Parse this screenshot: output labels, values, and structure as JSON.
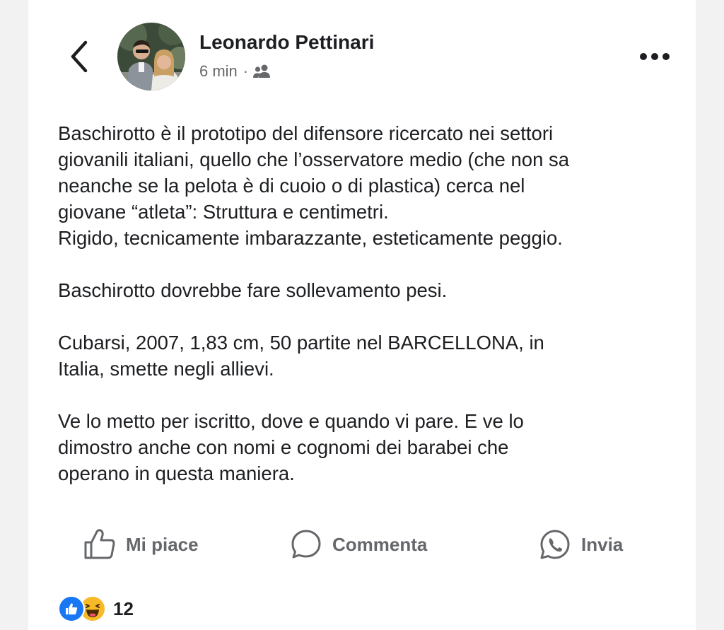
{
  "header": {
    "back_icon": "chevron-left-icon",
    "author_name": "Leonardo Pettinari",
    "time": "6 min",
    "separator": "·",
    "audience_icon": "friends-icon",
    "more_icon": "more-horizontal-icon"
  },
  "post": {
    "paragraphs": [
      {
        "lines": [
          "Baschirotto è il prototipo del difensore ricercato nei settori",
          "giovanili italiani, quello che l’osservatore medio (che non sa",
          "neanche se la pelota è di cuoio o di plastica) cerca nel",
          "giovane “atleta”: Struttura e centimetri.",
          "Rigido, tecnicamente imbarazzante, esteticamente peggio."
        ]
      },
      {
        "lines": [
          "Baschirotto dovrebbe fare sollevamento pesi."
        ]
      },
      {
        "lines": [
          "Cubarsi, 2007, 1,83 cm, 50 partite nel BARCELLONA, in",
          "Italia, smette negli allievi."
        ]
      },
      {
        "lines": [
          "Ve lo metto per iscritto, dove e quando vi pare. E ve lo",
          "dimostro anche con nomi e cognomi dei barabei che",
          "operano in questa maniera."
        ]
      }
    ]
  },
  "actions": {
    "like_label": "Mi piace",
    "comment_label": "Commenta",
    "send_label": "Invia"
  },
  "reactions": {
    "icons": [
      "like-reaction-icon",
      "haha-reaction-icon"
    ],
    "count": "12"
  },
  "colors": {
    "text": "#1c1e21",
    "secondary_text": "#65676b",
    "like_blue": "#1877f2",
    "haha_yellow": "#f7b928"
  }
}
